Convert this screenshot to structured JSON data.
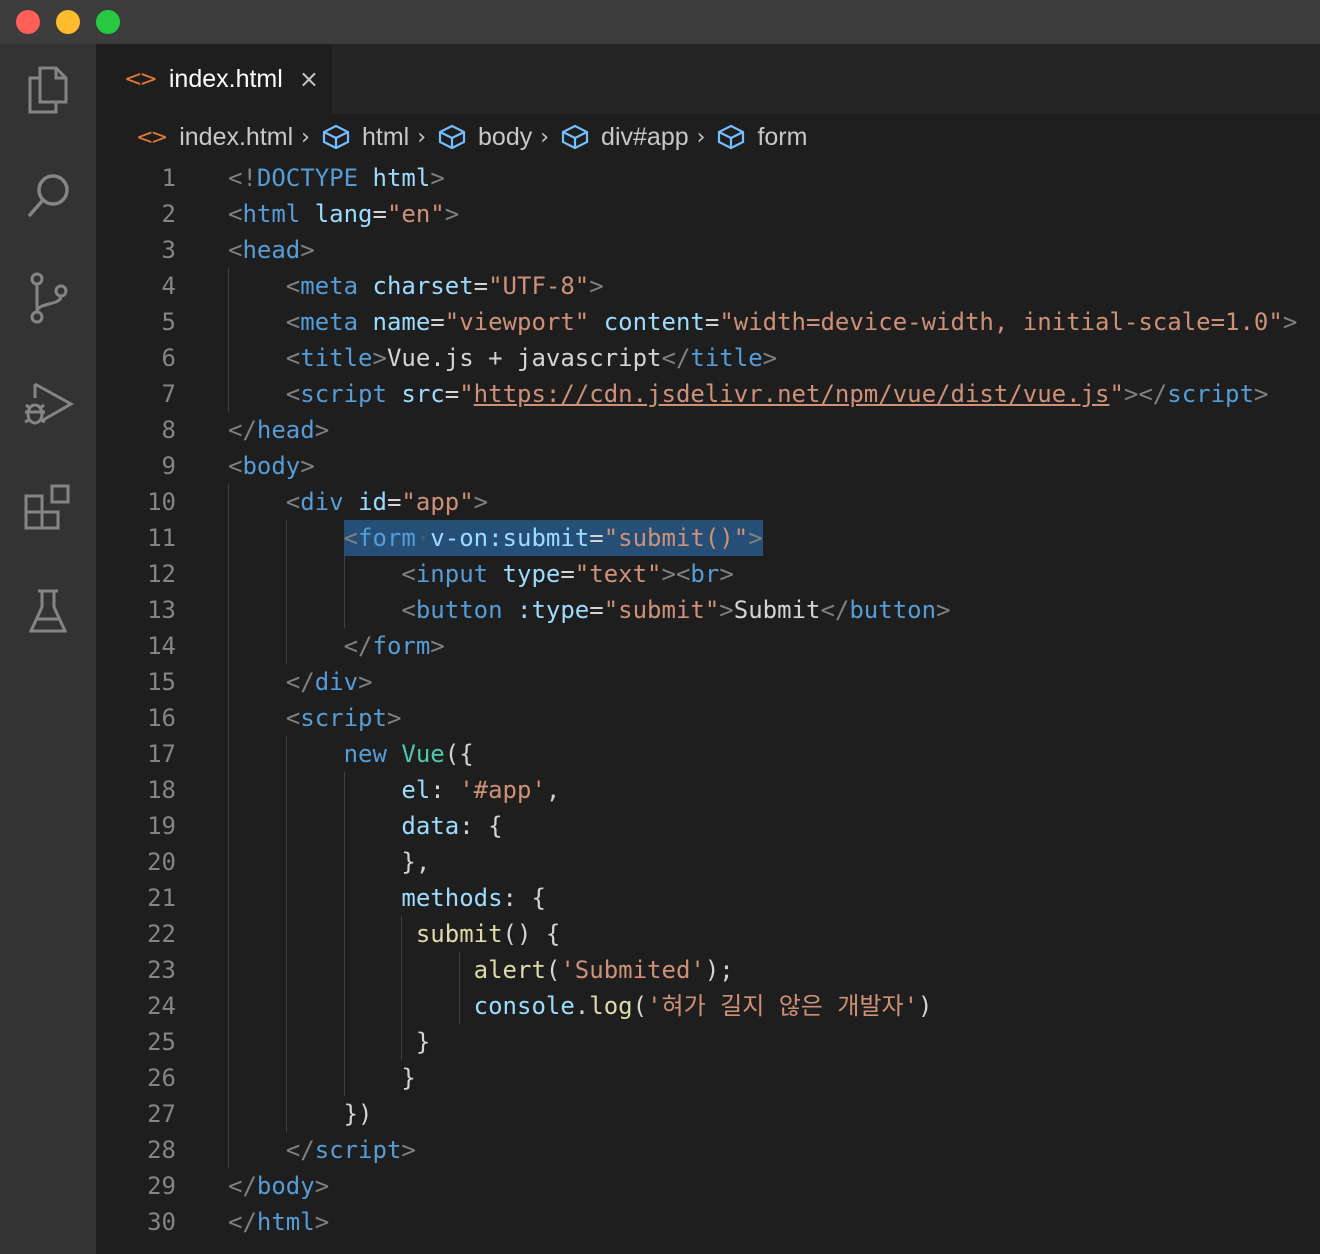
{
  "colors": {
    "close_light": "#ff5f57",
    "minimize_light": "#febc2e",
    "zoom_light": "#28c840",
    "html_icon": "#e37933",
    "selection": "#264f78"
  },
  "activity_bar": {
    "icons": [
      "files-icon",
      "search-icon",
      "source-control-icon",
      "run-debug-icon",
      "extensions-icon",
      "testing-icon"
    ]
  },
  "tab": {
    "label": "index.html",
    "close": "×"
  },
  "breadcrumb": {
    "file": "index.html",
    "items": [
      "html",
      "body",
      "div#app",
      "form"
    ]
  },
  "editor": {
    "lines": [
      {
        "n": "1",
        "indent": 0,
        "tokens": [
          [
            "p",
            "<!"
          ],
          [
            "t",
            "DOCTYPE"
          ],
          [
            "w",
            " "
          ],
          [
            "a",
            "html"
          ],
          [
            "p",
            ">"
          ]
        ]
      },
      {
        "n": "2",
        "indent": 0,
        "tokens": [
          [
            "p",
            "<"
          ],
          [
            "t",
            "html"
          ],
          [
            "w",
            " "
          ],
          [
            "a",
            "lang"
          ],
          [
            "w",
            "="
          ],
          [
            "s",
            "\"en\""
          ],
          [
            "p",
            ">"
          ]
        ]
      },
      {
        "n": "3",
        "indent": 0,
        "tokens": [
          [
            "p",
            "<"
          ],
          [
            "t",
            "head"
          ],
          [
            "p",
            ">"
          ]
        ]
      },
      {
        "n": "4",
        "indent": 4,
        "tokens": [
          [
            "p",
            "<"
          ],
          [
            "t",
            "meta"
          ],
          [
            "w",
            " "
          ],
          [
            "a",
            "charset"
          ],
          [
            "w",
            "="
          ],
          [
            "s",
            "\"UTF-8\""
          ],
          [
            "p",
            ">"
          ]
        ]
      },
      {
        "n": "5",
        "indent": 4,
        "tokens": [
          [
            "p",
            "<"
          ],
          [
            "t",
            "meta"
          ],
          [
            "w",
            " "
          ],
          [
            "a",
            "name"
          ],
          [
            "w",
            "="
          ],
          [
            "s",
            "\"viewport\""
          ],
          [
            "w",
            " "
          ],
          [
            "a",
            "content"
          ],
          [
            "w",
            "="
          ],
          [
            "s",
            "\"width=device-width, initial-scale=1.0\""
          ],
          [
            "p",
            ">"
          ]
        ]
      },
      {
        "n": "6",
        "indent": 4,
        "tokens": [
          [
            "p",
            "<"
          ],
          [
            "t",
            "title"
          ],
          [
            "p",
            ">"
          ],
          [
            "w",
            "Vue.js + javascript"
          ],
          [
            "p",
            "</"
          ],
          [
            "t",
            "title"
          ],
          [
            "p",
            ">"
          ]
        ]
      },
      {
        "n": "7",
        "indent": 4,
        "tokens": [
          [
            "p",
            "<"
          ],
          [
            "t",
            "script"
          ],
          [
            "w",
            " "
          ],
          [
            "a",
            "src"
          ],
          [
            "w",
            "="
          ],
          [
            "s",
            "\""
          ],
          [
            "u",
            "https://cdn.jsdelivr.net/npm/vue/dist/vue.js"
          ],
          [
            "s",
            "\""
          ],
          [
            "p",
            "></"
          ],
          [
            "t",
            "script"
          ],
          [
            "p",
            ">"
          ]
        ]
      },
      {
        "n": "8",
        "indent": 0,
        "tokens": [
          [
            "p",
            "</"
          ],
          [
            "t",
            "head"
          ],
          [
            "p",
            ">"
          ]
        ]
      },
      {
        "n": "9",
        "indent": 0,
        "tokens": [
          [
            "p",
            "<"
          ],
          [
            "t",
            "body"
          ],
          [
            "p",
            ">"
          ]
        ]
      },
      {
        "n": "10",
        "indent": 4,
        "tokens": [
          [
            "p",
            "<"
          ],
          [
            "t",
            "div"
          ],
          [
            "w",
            " "
          ],
          [
            "a",
            "id"
          ],
          [
            "w",
            "="
          ],
          [
            "s",
            "\"app\""
          ],
          [
            "p",
            ">"
          ]
        ]
      },
      {
        "n": "11",
        "indent": 8,
        "selected": true,
        "tokens": [
          [
            "p",
            "<"
          ],
          [
            "t",
            "form"
          ],
          [
            "dot",
            "·"
          ],
          [
            "a",
            "v-on:submit"
          ],
          [
            "w",
            "="
          ],
          [
            "s",
            "\"submit()\""
          ],
          [
            "p",
            ">"
          ]
        ]
      },
      {
        "n": "12",
        "indent": 12,
        "tokens": [
          [
            "p",
            "<"
          ],
          [
            "t",
            "input"
          ],
          [
            "w",
            " "
          ],
          [
            "a",
            "type"
          ],
          [
            "w",
            "="
          ],
          [
            "s",
            "\"text\""
          ],
          [
            "p",
            "><"
          ],
          [
            "t",
            "br"
          ],
          [
            "p",
            ">"
          ]
        ]
      },
      {
        "n": "13",
        "indent": 12,
        "tokens": [
          [
            "p",
            "<"
          ],
          [
            "t",
            "button"
          ],
          [
            "w",
            " "
          ],
          [
            "a",
            ":type"
          ],
          [
            "w",
            "="
          ],
          [
            "s",
            "\"submit\""
          ],
          [
            "p",
            ">"
          ],
          [
            "w",
            "Submit"
          ],
          [
            "p",
            "</"
          ],
          [
            "t",
            "button"
          ],
          [
            "p",
            ">"
          ]
        ]
      },
      {
        "n": "14",
        "indent": 8,
        "tokens": [
          [
            "p",
            "</"
          ],
          [
            "t",
            "form"
          ],
          [
            "p",
            ">"
          ]
        ]
      },
      {
        "n": "15",
        "indent": 4,
        "tokens": [
          [
            "p",
            "</"
          ],
          [
            "t",
            "div"
          ],
          [
            "p",
            ">"
          ]
        ]
      },
      {
        "n": "16",
        "indent": 4,
        "tokens": [
          [
            "p",
            "<"
          ],
          [
            "t",
            "script"
          ],
          [
            "p",
            ">"
          ]
        ]
      },
      {
        "n": "17",
        "indent": 8,
        "tokens": [
          [
            "k",
            "new"
          ],
          [
            "w",
            " "
          ],
          [
            "c",
            "Vue"
          ],
          [
            "w",
            "({"
          ]
        ]
      },
      {
        "n": "18",
        "indent": 12,
        "tokens": [
          [
            "a",
            "el"
          ],
          [
            "w",
            ": "
          ],
          [
            "s",
            "'#app'"
          ],
          [
            "w",
            ","
          ]
        ]
      },
      {
        "n": "19",
        "indent": 12,
        "tokens": [
          [
            "a",
            "data"
          ],
          [
            "w",
            ": {"
          ]
        ]
      },
      {
        "n": "20",
        "indent": 12,
        "tokens": [
          [
            "w",
            "},"
          ]
        ]
      },
      {
        "n": "21",
        "indent": 12,
        "tokens": [
          [
            "a",
            "methods"
          ],
          [
            "w",
            ": {"
          ]
        ]
      },
      {
        "n": "22",
        "indent": 13,
        "tokens": [
          [
            "f",
            "submit"
          ],
          [
            "w",
            "() {"
          ]
        ]
      },
      {
        "n": "23",
        "indent": 17,
        "tokens": [
          [
            "f",
            "alert"
          ],
          [
            "w",
            "("
          ],
          [
            "s",
            "'Submited'"
          ],
          [
            "w",
            ");"
          ]
        ]
      },
      {
        "n": "24",
        "indent": 17,
        "tokens": [
          [
            "a",
            "console"
          ],
          [
            "w",
            "."
          ],
          [
            "f",
            "log"
          ],
          [
            "w",
            "("
          ],
          [
            "s",
            "'혀가 길지 않은 개발자'"
          ],
          [
            "w",
            ")"
          ]
        ]
      },
      {
        "n": "25",
        "indent": 13,
        "tokens": [
          [
            "w",
            "}"
          ]
        ]
      },
      {
        "n": "26",
        "indent": 12,
        "tokens": [
          [
            "w",
            "}"
          ]
        ]
      },
      {
        "n": "27",
        "indent": 8,
        "tokens": [
          [
            "w",
            "})"
          ]
        ]
      },
      {
        "n": "28",
        "indent": 4,
        "tokens": [
          [
            "p",
            "</"
          ],
          [
            "t",
            "script"
          ],
          [
            "p",
            ">"
          ]
        ]
      },
      {
        "n": "29",
        "indent": 0,
        "tokens": [
          [
            "p",
            "</"
          ],
          [
            "t",
            "body"
          ],
          [
            "p",
            ">"
          ]
        ]
      },
      {
        "n": "30",
        "indent": 0,
        "tokens": [
          [
            "p",
            "</"
          ],
          [
            "t",
            "html"
          ],
          [
            "p",
            ">"
          ]
        ]
      }
    ]
  }
}
